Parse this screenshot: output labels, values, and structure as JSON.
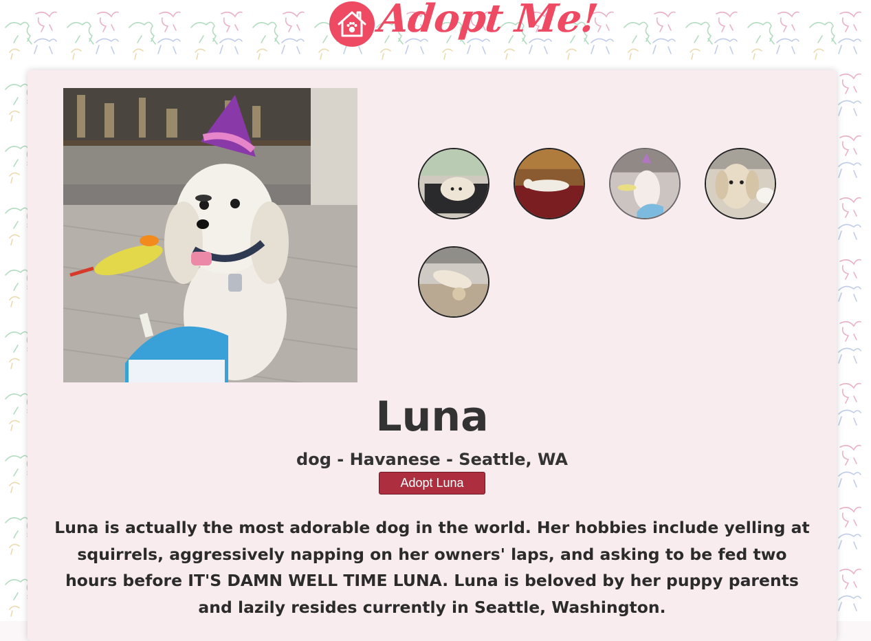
{
  "app": {
    "logo_text": "Adopt Me!",
    "brand_color": "#ee4a63"
  },
  "pet": {
    "name": "Luna",
    "details": "dog - Havanese - Seattle, WA",
    "adopt_label": "Adopt Luna",
    "description": "Luna is actually the most adorable dog in the world. Her hobbies include yelling at squirrels, aggressively napping on her owners' laps, and asking to be fed two hours before IT'S DAMN WELL TIME LUNA. Luna is beloved by her puppy parents and lazily resides currently in Seattle, Washington.",
    "selected_image": 3
  },
  "colors": {
    "card_bg": "#f8ecef",
    "button_bg": "#ad2f3f",
    "text": "#333333"
  },
  "icons": {
    "logo": "house-paw-icon"
  }
}
